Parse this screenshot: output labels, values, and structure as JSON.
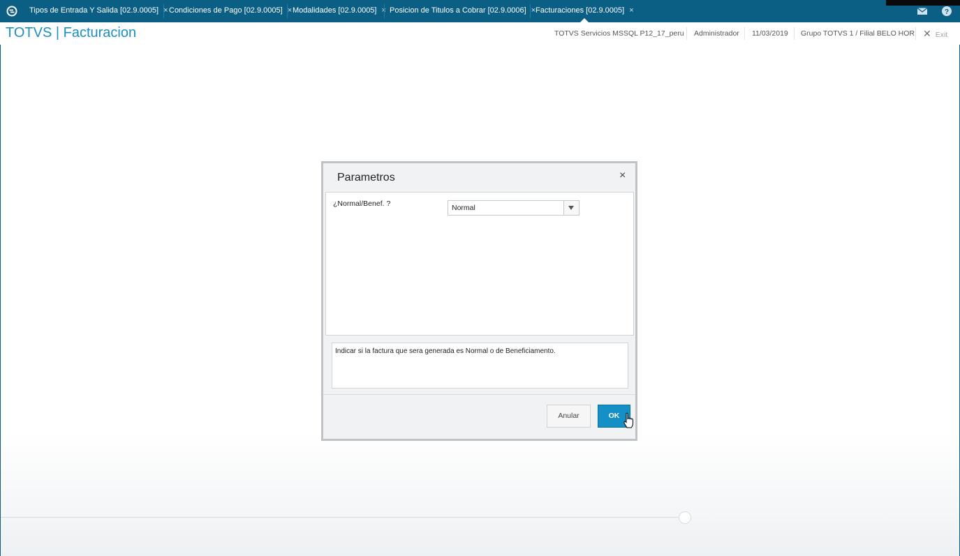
{
  "tabs": [
    {
      "label": "Tipos de Entrada Y Salida [02.9.0005]",
      "close": "×"
    },
    {
      "label": "Condiciones de Pago [02.9.0005]",
      "close": "×"
    },
    {
      "label": "Modalidades [02.9.0005]",
      "close": "×"
    },
    {
      "label": "Posicion de Titulos a Cobrar [02.9.0006]",
      "close": "×"
    },
    {
      "label": "Facturaciones [02.9.0005]",
      "close": "×"
    }
  ],
  "header": {
    "brand": "TOTVS | Facturacion",
    "environment": "TOTVS Servicios MSSQL P12_17_peru",
    "user": "Administrador",
    "date": "11/03/2019",
    "branch": "Grupo TOTVS 1 / Filial BELO HOR",
    "exit_label": "Exit"
  },
  "icons": {
    "logo": "totvs-logo-icon",
    "mail": "mail-icon",
    "help": "help-icon",
    "exit": "close-icon"
  },
  "dialog": {
    "title": "Parametros",
    "close": "×",
    "param_label": "¿Normal/Benef. ?",
    "param_value": "Normal",
    "help_text": "Indicar si la factura que sera generada es Normal o de Beneficiamento.",
    "cancel_label": "Anular",
    "ok_label": "OK"
  },
  "colors": {
    "topbar": "#0b5f84",
    "brand": "#1b8fc0",
    "ok_button": "#1590c6"
  }
}
